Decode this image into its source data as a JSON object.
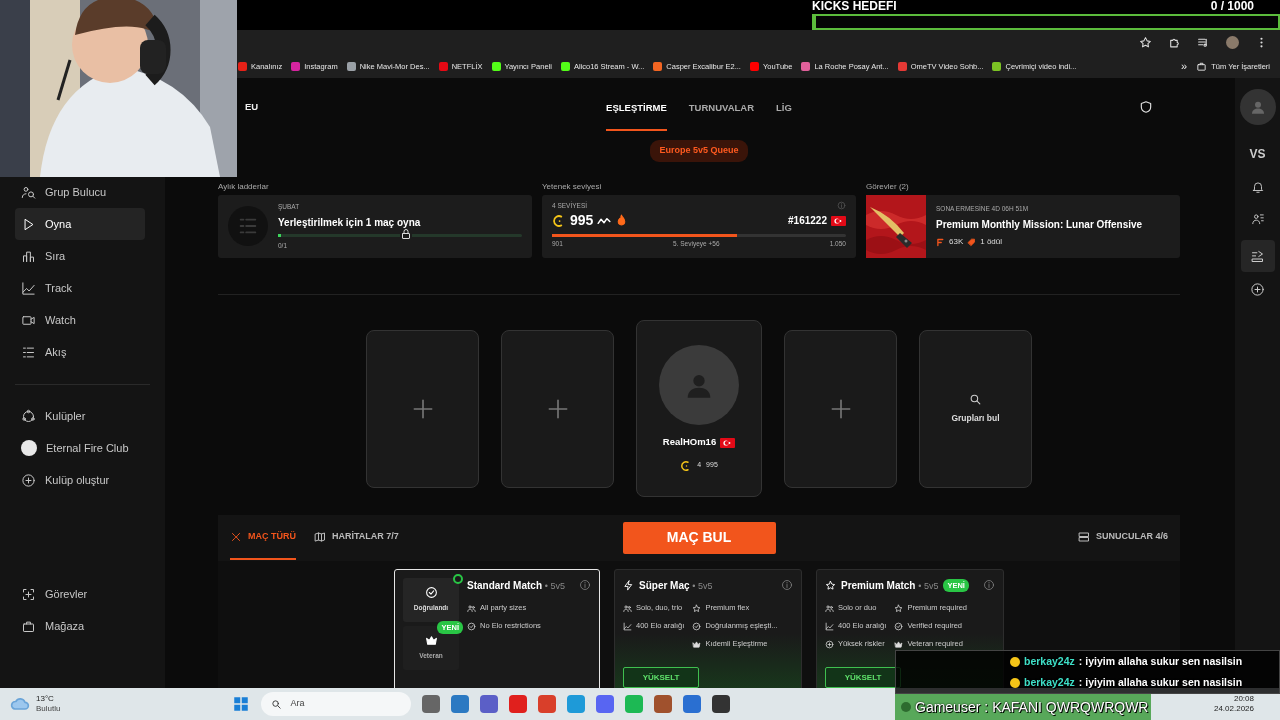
{
  "stream_overlay": {
    "goal": {
      "title": "KICKS HEDEFI",
      "count": "0 / 1000",
      "level": 0
    }
  },
  "bookmarks": [
    {
      "label": "Kanalınız",
      "color": "#e62117"
    },
    {
      "label": "Instagram",
      "color": "#d6249f"
    },
    {
      "label": "Nike Mavi-Mor Des...",
      "color": "#9aa0a6"
    },
    {
      "label": "NETFLİX",
      "color": "#e50914"
    },
    {
      "label": "Yayıncı Paneli",
      "color": "#53fc18"
    },
    {
      "label": "Alico16 Stream - W...",
      "color": "#53fc18"
    },
    {
      "label": "Casper Excalibur E2...",
      "color": "#f26522"
    },
    {
      "label": "YouTube",
      "color": "#ff0000"
    },
    {
      "label": "La Roche Posay Ant...",
      "color": "#e0609a"
    },
    {
      "label": "OmeTV Video Sohb...",
      "color": "#e53935"
    },
    {
      "label": "Çevrimiçi video indi...",
      "color": "#7cc324"
    }
  ],
  "bookmarks_more": "»",
  "all_bookmarks": "Tüm Yer İşaretleri",
  "sidebar": {
    "main": [
      {
        "label": "Grup Bulucu",
        "selected": false
      },
      {
        "label": "Oyna",
        "selected": true
      },
      {
        "label": "Sıra",
        "selected": false
      },
      {
        "label": "Track",
        "selected": false
      },
      {
        "label": "Watch",
        "selected": false
      },
      {
        "label": "Akış",
        "selected": false
      }
    ],
    "clubs": [
      {
        "label": "Kulüpler"
      },
      {
        "label": "Eternal Fire Club"
      },
      {
        "label": "Kulüp oluştur"
      }
    ],
    "bottom": [
      {
        "label": "Görevler"
      },
      {
        "label": "Mağaza"
      }
    ]
  },
  "region": "EU",
  "tabs": [
    {
      "label": "EŞLEŞTİRME",
      "selected": true
    },
    {
      "label": "TURNUVALAR",
      "selected": false
    },
    {
      "label": "LİG",
      "selected": false
    }
  ],
  "queue_badge": "Europe 5v5 Queue",
  "ladder": {
    "heading": "Aylık ladderlar",
    "month": "ŞUBAT",
    "title": "Yerleştirilmek için 1 maç oyna",
    "progress": "0/1",
    "level": 0
  },
  "skill": {
    "heading": "Yetenek seviyesi",
    "tier": "4 SEVİYESİ",
    "elo": "995",
    "rank": "#161222",
    "min": "901",
    "next": "5. Seviyeye +56",
    "max": "1.050",
    "level": 0.63
  },
  "missions": {
    "heading": "Görevler (2)",
    "expires": "SONA ERMESİNE 4D 06H 51M",
    "title": "Premium Monthly Mission: Lunar Offensive",
    "points": "63K",
    "rewards": "1 ödül"
  },
  "party": [
    {
      "kind": "empty"
    },
    {
      "kind": "empty"
    },
    {
      "kind": "player",
      "name": "RealHOm16",
      "tier": "4",
      "elo": "995"
    },
    {
      "kind": "empty"
    },
    {
      "kind": "search",
      "label": "Grupları bul"
    }
  ],
  "match_bar": {
    "tabs": [
      {
        "label": "MAÇ TÜRÜ",
        "selected": true
      },
      {
        "label": "HARİTALAR 7/7",
        "selected": false
      }
    ],
    "find_button": "MAÇ BUL",
    "servers": "SUNUCULAR 4/6"
  },
  "match_types": [
    {
      "kind": "standard",
      "title": "Standard Match",
      "mode": "• 5v5",
      "selected": true,
      "options": [
        {
          "label": "Doğrulandı",
          "selected": true
        },
        {
          "label": "Veteran",
          "badge": "YENİ",
          "selected": false
        }
      ],
      "columns": [
        [
          "All party sizes",
          "No Elo restrictions"
        ]
      ]
    },
    {
      "kind": "upgrade",
      "title": "Süper Maç",
      "mode": "• 5v5",
      "selected": false,
      "columns": [
        [
          "Solo, duo, trio",
          "400 Elo aralığı"
        ],
        [
          "Premium flex",
          "Doğrulanmış eşleşti...",
          "Kıdemli Eşleştirme"
        ]
      ],
      "button": "YÜKSELT"
    },
    {
      "kind": "upgrade",
      "title": "Premium Match",
      "mode": "• 5v5",
      "badge": "YENİ",
      "selected": false,
      "columns": [
        [
          "Solo or duo",
          "400 Elo aralığı",
          "Yüksek riskler"
        ],
        [
          "Premium required",
          "Verified required",
          "Veteran required"
        ]
      ],
      "button": "YÜKSELT"
    }
  ],
  "rail": {
    "vs": "VS"
  },
  "chat": [
    {
      "user": "berkay24z",
      "message": ": iyiyim allaha sukur sen nasilsin"
    },
    {
      "user": "berkay24z",
      "message": ": iyiyim allaha sukur sen nasilsin"
    },
    {
      "user": "Gameuser",
      "message": ": KAFANI QWRQWRQWR"
    }
  ],
  "taskbar": {
    "temperature": "13°C",
    "weather": "Bulutlu",
    "search": "Ara",
    "time": "20:08",
    "date": "24.02.2026"
  }
}
